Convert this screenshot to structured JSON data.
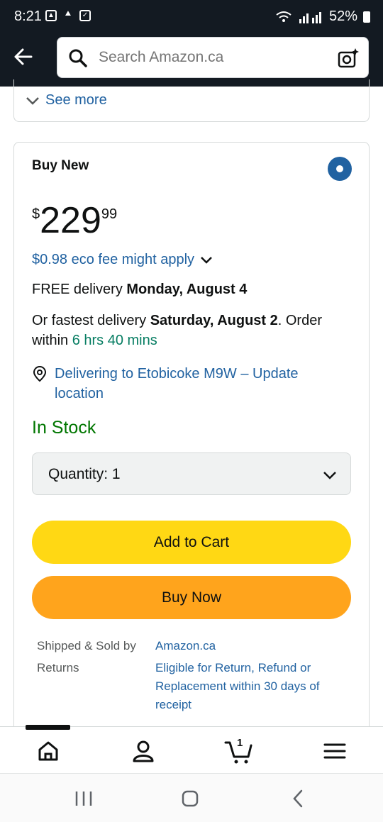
{
  "status_bar": {
    "time": "8:21",
    "battery": "52%"
  },
  "header": {
    "search_placeholder": "Search Amazon.ca"
  },
  "see_more": {
    "label": "See more"
  },
  "buy_box": {
    "title": "Buy New",
    "price": {
      "currency": "$",
      "whole": "229",
      "fraction": "99"
    },
    "eco_fee": "$0.98 eco fee might apply",
    "delivery": {
      "prefix": "FREE delivery ",
      "date": "Monday, August 4"
    },
    "fastest": {
      "prefix": "Or fastest delivery ",
      "date": "Saturday, August 2",
      "order_within": ". Order",
      "within_label": "within ",
      "countdown": "6 hrs 40 mins"
    },
    "location": "Delivering to Etobicoke M9W – Update location",
    "stock": "In Stock",
    "quantity": "Quantity:  1",
    "add_to_cart": "Add to Cart",
    "buy_now": "Buy Now",
    "shipped_sold_label": "Shipped & Sold by",
    "shipped_sold_value": "Amazon.ca",
    "returns_label": "Returns",
    "returns_value": "Eligible for Return, Refund or Replacement within 30 days of receipt"
  },
  "bottom_nav": {
    "cart_count": "1"
  },
  "colors": {
    "header_bg": "#131a22",
    "link": "#2162a1",
    "add_to_cart": "#ffd814",
    "buy_now": "#ffa41c",
    "in_stock": "#007600"
  }
}
